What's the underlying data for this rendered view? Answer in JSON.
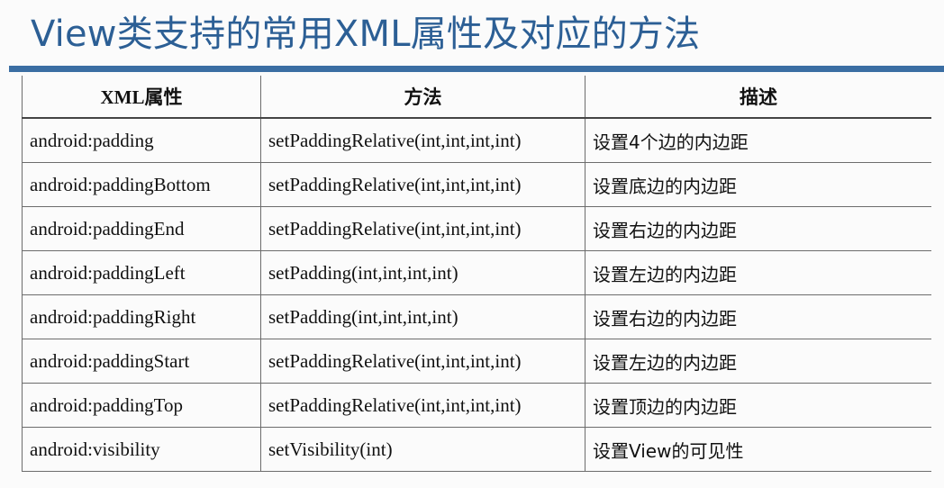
{
  "slide": {
    "title": "View类支持的常用XML属性及对应的方法"
  },
  "table": {
    "headers": [
      "XML属性",
      "方法",
      "描述"
    ],
    "rows": [
      [
        "android:padding",
        "setPaddingRelative(int,int,int,int)",
        "设置4个边的内边距"
      ],
      [
        "android:paddingBottom",
        "setPaddingRelative(int,int,int,int)",
        "设置底边的内边距"
      ],
      [
        "android:paddingEnd",
        "setPaddingRelative(int,int,int,int)",
        "设置右边的内边距"
      ],
      [
        "android:paddingLeft",
        "setPadding(int,int,int,int)",
        "设置左边的内边距"
      ],
      [
        "android:paddingRight",
        "setPadding(int,int,int,int)",
        "设置右边的内边距"
      ],
      [
        "android:paddingStart",
        "setPaddingRelative(int,int,int,int)",
        "设置左边的内边距"
      ],
      [
        "android:paddingTop",
        "setPaddingRelative(int,int,int,int)",
        "设置顶边的内边距"
      ],
      [
        "android:visibility",
        "setVisibility(int)",
        "设置View的可见性"
      ]
    ]
  },
  "colors": {
    "title": "#2c5f95",
    "rule": "#3b6ea3",
    "grid": "#6c6c6c"
  }
}
